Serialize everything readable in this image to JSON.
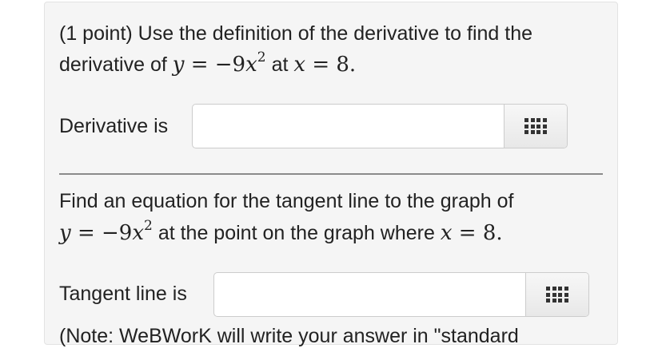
{
  "problem": {
    "part1": {
      "line1": "(1 point) Use the definition of the derivative to find the",
      "line2_prefix": "derivative of",
      "function_lhs": "y",
      "function_rhs": "= −9",
      "var": "x",
      "exponent": "2",
      "at": "at",
      "point_var": "x",
      "point_rhs": "= 8."
    },
    "derivative_label": "Derivative is",
    "derivative_value": "",
    "part2": {
      "line1": "Find an equation for the tangent line to the graph of",
      "function_lhs": "y",
      "function_rhs": "= −9",
      "var": "x",
      "exponent": "2",
      "middle": "at the point on the graph where",
      "point_var": "x",
      "point_rhs": "= 8."
    },
    "tangent_label": "Tangent line is",
    "tangent_value": "",
    "note_partial": "(Note: WeBWorK will write your answer in \"standard"
  }
}
